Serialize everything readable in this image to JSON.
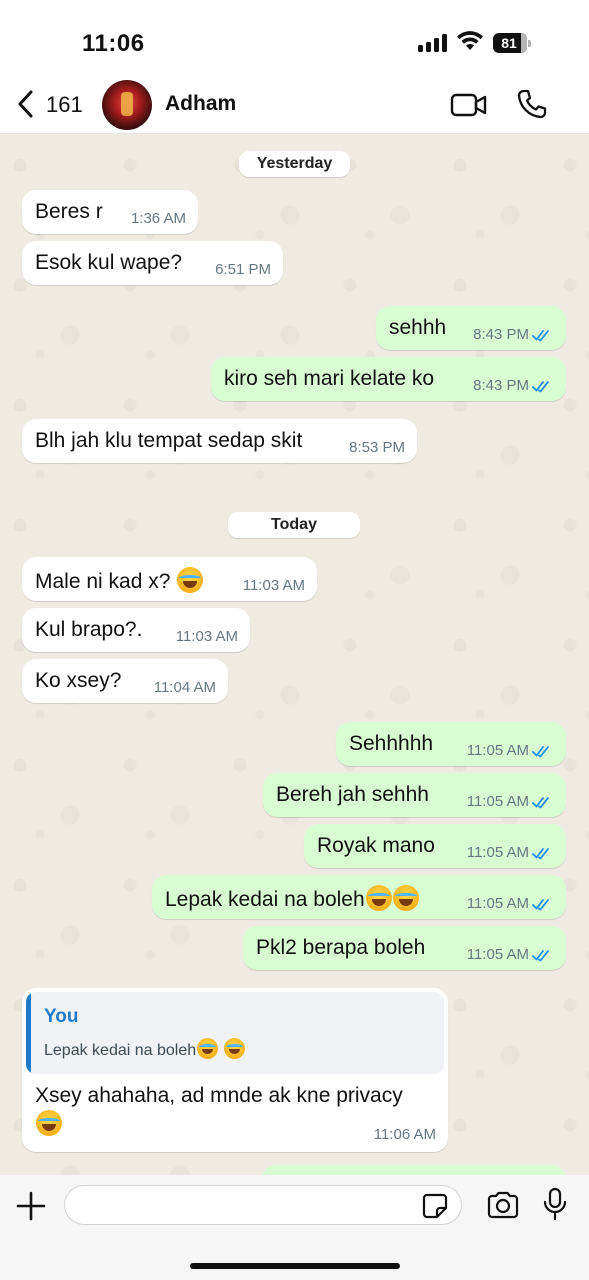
{
  "status_bar": {
    "time": "11:06",
    "battery": "81"
  },
  "header": {
    "back_count": "161",
    "contact_name": "Adham"
  },
  "date_chips": {
    "yesterday": "Yesterday",
    "today": "Today"
  },
  "messages": [
    {
      "dir": "in",
      "text": "Beres r",
      "time": "1:36 AM"
    },
    {
      "dir": "in",
      "text": "Esok kul wape?",
      "time": "6:51 PM"
    },
    {
      "dir": "out",
      "text": "sehhh",
      "time": "8:43 PM"
    },
    {
      "dir": "out",
      "text": "kiro seh mari kelate ko",
      "time": "8:43 PM"
    },
    {
      "dir": "in",
      "text": "Blh jah klu tempat sedap skit",
      "time": "8:53 PM"
    },
    {
      "dir": "in",
      "text": "Male ni kad x?",
      "emoji": "joy-emoji",
      "time": "11:03 AM"
    },
    {
      "dir": "in",
      "text": "Kul brapo?.",
      "time": "11:03 AM"
    },
    {
      "dir": "in",
      "text": "Ko xsey?",
      "time": "11:04 AM"
    },
    {
      "dir": "out",
      "text": "Sehhhhh",
      "time": "11:05 AM"
    },
    {
      "dir": "out",
      "text": "Bereh jah sehhh",
      "time": "11:05 AM"
    },
    {
      "dir": "out",
      "text": "Royak mano",
      "time": "11:05 AM"
    },
    {
      "dir": "out",
      "text": "Lepak kedai na boleh",
      "emoji": "joy-emoji x2",
      "time": "11:05 AM"
    },
    {
      "dir": "out",
      "text": "Pkl2 berapa boleh",
      "time": "11:05 AM"
    }
  ],
  "reply": {
    "quoted_author": "You",
    "quoted_text": "Lepak kedai na boleh",
    "text": "Xsey ahahaha, ad mnde ak kne privacy",
    "time": "11:06 AM"
  },
  "input": {
    "placeholder": ""
  },
  "colors": {
    "incoming": "#ffffff",
    "outgoing": "#d9fdd3",
    "read_ticks": "#1f8ff0",
    "quote_accent": "#1f7ac9"
  },
  "icons": [
    "back-chevron",
    "video-call",
    "phone",
    "plus",
    "sticker",
    "camera",
    "microphone"
  ]
}
